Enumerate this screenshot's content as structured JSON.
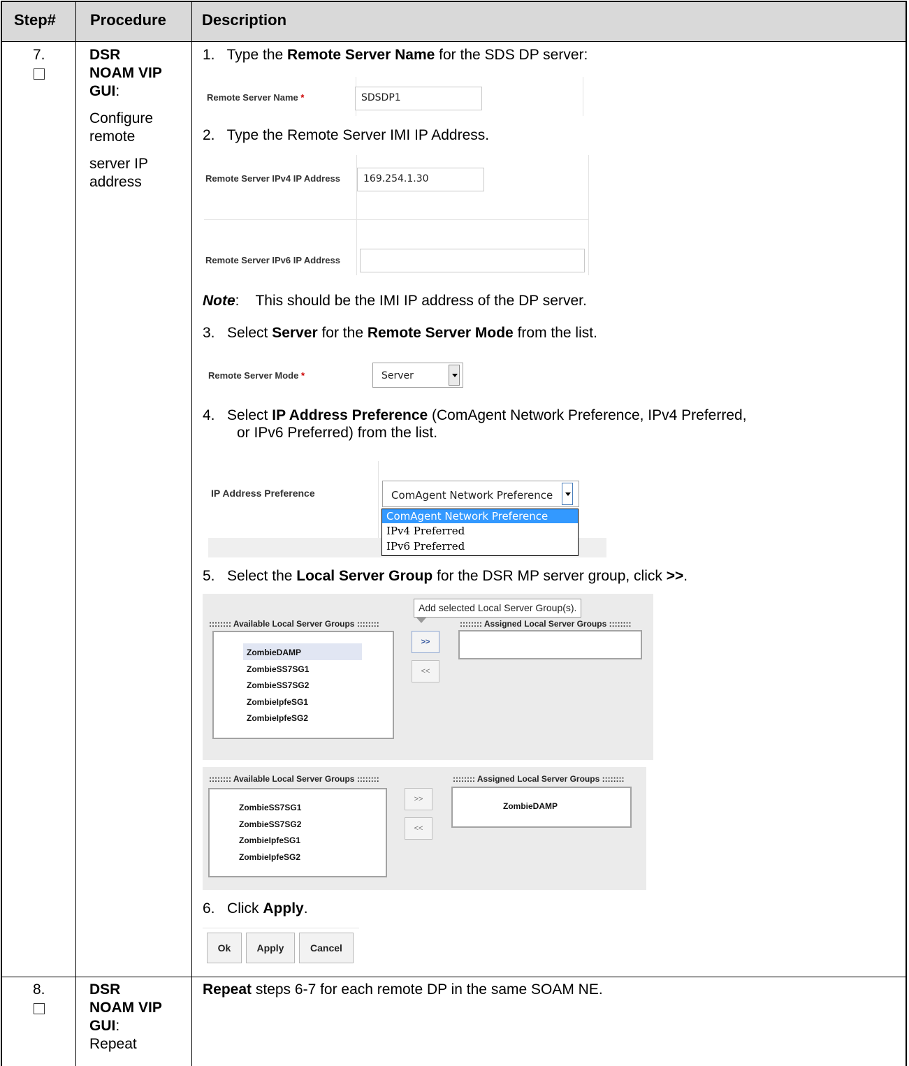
{
  "header": {
    "step": "Step#",
    "procedure": "Procedure",
    "description": "Description"
  },
  "row7": {
    "step_num": "7.",
    "proc_bold_1": "DSR",
    "proc_bold_2": "NOAM VIP",
    "proc_bold_3": "GUI",
    "proc_colon": ":",
    "proc_l4": "Configure",
    "proc_l5": "remote",
    "proc_l6": "server IP",
    "proc_l7": "address",
    "s1": {
      "num": "1.",
      "pre": "Type the ",
      "bold": "Remote Server Name",
      "post": " for the SDS DP server:"
    },
    "name_field": {
      "label": "Remote Server Name",
      "req": "*",
      "value": "SDSDP1"
    },
    "s2": {
      "num": "2.",
      "text": "Type the Remote Server IMI IP Address."
    },
    "ipv4_field": {
      "label": "Remote Server IPv4 IP Address",
      "value": "169.254.1.30"
    },
    "ipv6_field": {
      "label": "Remote Server IPv6 IP Address",
      "value": ""
    },
    "note": {
      "label": "Note",
      "colon": ":",
      "text": "This should be the IMI IP address of the DP server."
    },
    "s3": {
      "num": "3.",
      "pre": "Select ",
      "bold1": "Server",
      "mid": " for the ",
      "bold2": "Remote Server Mode",
      "post": " from the list."
    },
    "mode_field": {
      "label": "Remote Server Mode",
      "req": "*",
      "value": "Server"
    },
    "s4": {
      "num": "4.",
      "pre": "Select ",
      "bold": "IP Address Preference",
      "post": " (ComAgent Network Preference, IPv4 Preferred,",
      "line2": "or IPv6 Preferred) from the list."
    },
    "pref_field": {
      "label": "IP Address Preference",
      "value": "ComAgent Network Preference",
      "options": [
        "ComAgent Network Preference",
        "IPv4 Preferred",
        "IPv6 Preferred"
      ]
    },
    "s5": {
      "num": "5.",
      "pre": "Select the ",
      "bold": "Local Server Group",
      "post": " for the DSR MP server group, click ",
      "bold2": ">>",
      "end": "."
    },
    "tooltip": "Add selected Local Server Group(s).",
    "panel1": {
      "available_header": ":::::::: Available Local Server Groups ::::::::",
      "assigned_header": ":::::::: Assigned Local Server Groups ::::::::",
      "available": [
        "ZombieDAMP",
        "ZombieSS7SG1",
        "ZombieSS7SG2",
        "ZombieIpfeSG1",
        "ZombieIpfeSG2"
      ],
      "add": ">>",
      "remove": "<<"
    },
    "panel2": {
      "available_header": ":::::::: Available Local Server Groups ::::::::",
      "assigned_header": ":::::::: Assigned Local Server Groups ::::::::",
      "available": [
        "ZombieSS7SG1",
        "ZombieSS7SG2",
        "ZombieIpfeSG1",
        "ZombieIpfeSG2"
      ],
      "assigned": [
        "ZombieDAMP"
      ],
      "add": ">>",
      "remove": "<<"
    },
    "s6": {
      "num": "6.",
      "pre": "Click ",
      "bold": "Apply",
      "post": "."
    },
    "buttons": {
      "ok": "Ok",
      "apply": "Apply",
      "cancel": "Cancel"
    }
  },
  "row8": {
    "step_num": "8.",
    "proc_bold_1": "DSR",
    "proc_bold_2": "NOAM VIP",
    "proc_bold_3": "GUI",
    "proc_colon": ":",
    "proc_l4": "Repeat",
    "desc_bold": "Repeat",
    "desc_rest": " steps 6-7 for each remote DP in the same SOAM NE."
  }
}
